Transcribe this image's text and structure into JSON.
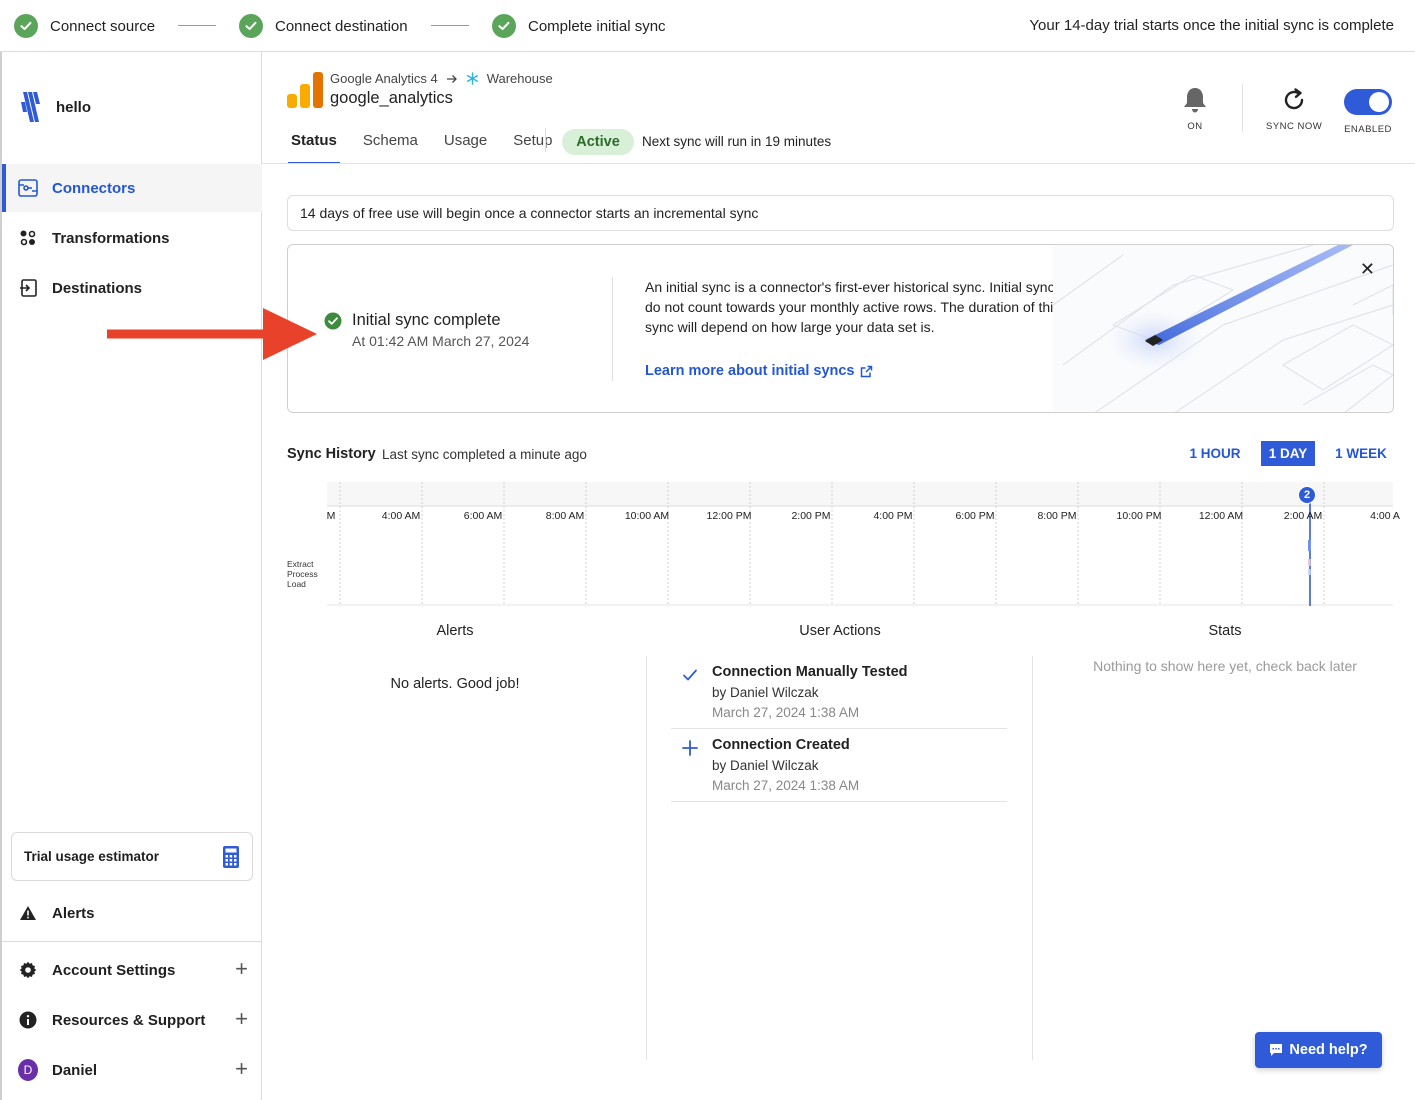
{
  "onboarding": {
    "steps": [
      {
        "label": "Connect source"
      },
      {
        "label": "Connect destination"
      },
      {
        "label": "Complete initial sync"
      }
    ],
    "trial_note": "Your 14-day trial starts once the initial sync is complete"
  },
  "sidebar": {
    "brand": "hello",
    "nav": [
      {
        "label": "Connectors",
        "active": true,
        "icon": "connectors-icon"
      },
      {
        "label": "Transformations",
        "active": false,
        "icon": "transformations-icon"
      },
      {
        "label": "Destinations",
        "active": false,
        "icon": "destinations-icon"
      }
    ],
    "estimator_label": "Trial usage estimator",
    "alerts_label": "Alerts",
    "account_settings": "Account Settings",
    "resources_support": "Resources & Support",
    "user": {
      "name": "Daniel",
      "initial": "D"
    }
  },
  "connector": {
    "source": "Google Analytics 4",
    "destination": "Warehouse",
    "name": "google_analytics",
    "tabs": [
      "Status",
      "Schema",
      "Usage",
      "Setup"
    ],
    "active_tab": "Status",
    "status": "Active",
    "next_sync": "Next sync will run in 19 minutes",
    "actions": {
      "notifications": "ON",
      "sync_now": "SYNC NOW",
      "enabled": "ENABLED"
    }
  },
  "free_banner": "14 days of free use will begin once a connector starts an incremental sync",
  "sync_card": {
    "title": "Initial sync complete",
    "time": "At 01:42 AM March 27, 2024",
    "description": "An initial sync is a connector's first-ever historical sync. Initial syncs do not count towards your monthly active rows. The duration of this sync will depend on how large your data set is.",
    "link": "Learn more about initial syncs"
  },
  "sync_history": {
    "title": "Sync History",
    "subtitle": "Last sync completed a minute ago",
    "ranges": [
      {
        "label": "1 HOUR",
        "selected": false
      },
      {
        "label": "1 DAY",
        "selected": true
      },
      {
        "label": "1 WEEK",
        "selected": false
      }
    ],
    "time_labels": [
      "M",
      "4:00 AM",
      "6:00 AM",
      "8:00 AM",
      "10:00 AM",
      "12:00 PM",
      "2:00 PM",
      "4:00 PM",
      "6:00 PM",
      "8:00 PM",
      "10:00 PM",
      "12:00 AM",
      "2:00 AM",
      "4:00 A"
    ],
    "legend": [
      "Extract",
      "Process",
      "Load"
    ],
    "marker_count": "2"
  },
  "columns": {
    "alerts": {
      "heading": "Alerts",
      "empty": "No alerts. Good job!"
    },
    "user_actions": {
      "heading": "User Actions",
      "items": [
        {
          "title": "Connection Manually Tested",
          "by": "by Daniel Wilczak",
          "date": "March 27, 2024 1:38 AM",
          "icon": "check-icon"
        },
        {
          "title": "Connection Created",
          "by": "by Daniel Wilczak",
          "date": "March 27, 2024 1:38 AM",
          "icon": "plus-icon"
        }
      ]
    },
    "stats": {
      "heading": "Stats",
      "empty": "Nothing to show here yet, check back later"
    }
  },
  "help_button": "Need help?",
  "colors": {
    "accent": "#2f5bd8",
    "success": "#5ba55b",
    "annotation": "#e8432a"
  }
}
